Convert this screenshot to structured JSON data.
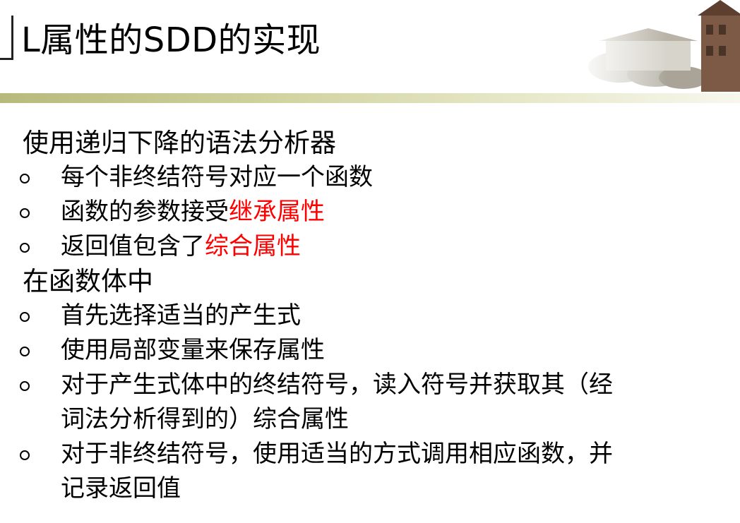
{
  "title": "L属性的SDD的实现",
  "header_image": "campus-tower-illustration",
  "colors": {
    "text": "#000000",
    "highlight": "#ff0000",
    "divider": "#b7b97c"
  },
  "sections": [
    {
      "heading": "使用递归下降的语法分析器",
      "items": [
        {
          "text": "每个非终结符号对应一个函数",
          "highlight": ""
        },
        {
          "text": "函数的参数接受",
          "highlight": "继承属性"
        },
        {
          "text": "返回值包含了",
          "highlight": "综合属性"
        }
      ]
    },
    {
      "heading": "在函数体中",
      "items": [
        {
          "text": "首先选择适当的产生式"
        },
        {
          "text": "使用局部变量来保存属性"
        },
        {
          "line1": "对于产生式体中的终结符号，读入符号并获取其（经",
          "line2": "词法分析得到的）综合属性"
        },
        {
          "line1": "对于非终结符号，使用适当的方式调用相应函数，并",
          "line2": "记录返回值"
        }
      ]
    }
  ]
}
